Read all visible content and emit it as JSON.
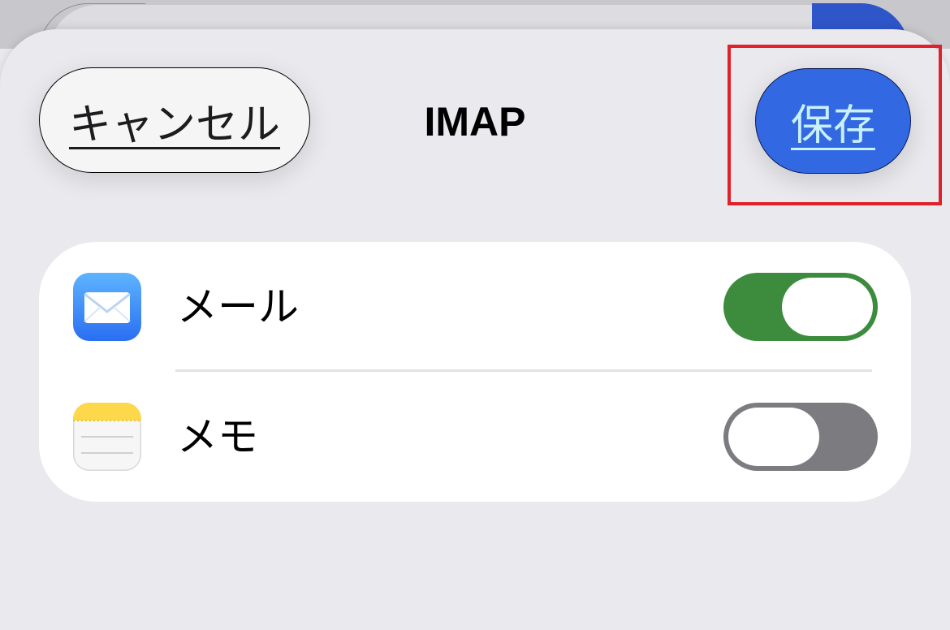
{
  "nav": {
    "cancel_label": "キャンセル",
    "title": "IMAP",
    "save_label": "保存"
  },
  "settings": {
    "items": [
      {
        "label": "メール",
        "icon": "mail-icon",
        "toggle_on": true
      },
      {
        "label": "メモ",
        "icon": "notes-icon",
        "toggle_on": false
      }
    ]
  },
  "colors": {
    "accent": "#3269e3",
    "toggle_on": "#3d8b3d",
    "toggle_off": "#7c7b80",
    "highlight": "#e0202a",
    "background": "#e9e9ee"
  }
}
